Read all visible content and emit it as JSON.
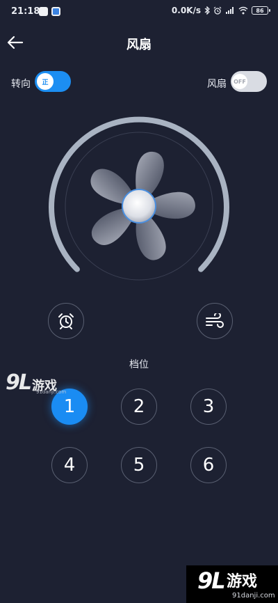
{
  "status_bar": {
    "time": "21:18",
    "network_speed": "0.0K/s",
    "battery": "86"
  },
  "header": {
    "title": "风扇",
    "back_icon": "arrow-left-icon"
  },
  "direction_toggle": {
    "label": "转向",
    "state": "正",
    "on": true
  },
  "fan_toggle": {
    "label": "风扇",
    "state": "OFF",
    "on": false
  },
  "controls": {
    "timer_icon": "alarm-clock-icon",
    "wind_mode_icon": "wind-icon"
  },
  "gear": {
    "label": "档位",
    "levels": [
      "1",
      "2",
      "3",
      "4",
      "5",
      "6"
    ],
    "selected": "1"
  },
  "watermark": {
    "logo_number": "9L",
    "logo_text": "游戏",
    "small_url": "91danji.com",
    "url": "91danji.com"
  },
  "colors": {
    "background": "#1d2132",
    "accent": "#1c8ef2",
    "arc": "#a9b3c2"
  }
}
